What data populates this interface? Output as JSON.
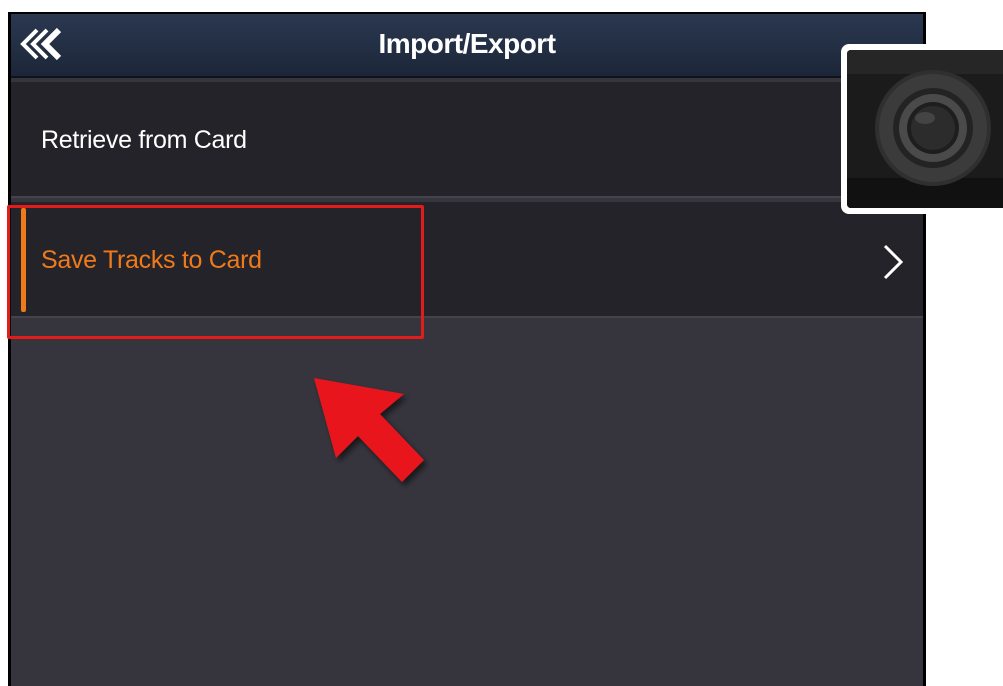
{
  "header": {
    "title": "Import/Export",
    "back_icon": "double-chevron-left-icon"
  },
  "menu": {
    "items": [
      {
        "label": "Retrieve from Card",
        "selected": false
      },
      {
        "label": "Save Tracks to Card",
        "selected": true,
        "chevron_icon": "chevron-right-icon"
      }
    ]
  },
  "annotations": {
    "highlight_color": "#e21b1b",
    "arrow_icon": "red-arrow-up-left-icon",
    "inset_image": "rotary-knob-photo"
  },
  "colors": {
    "accent": "#f07a1a",
    "title_bar": "#1c2638",
    "list_bg": "#24232a",
    "screen_bg": "#36343d"
  }
}
